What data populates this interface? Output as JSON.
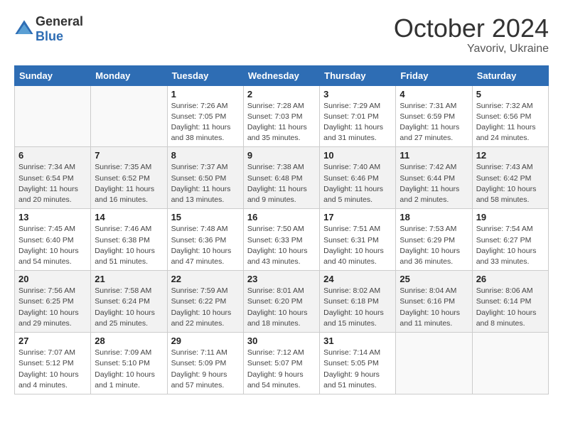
{
  "header": {
    "logo": {
      "text_general": "General",
      "text_blue": "Blue"
    },
    "title": "October 2024",
    "location": "Yavoriv, Ukraine"
  },
  "calendar": {
    "days_of_week": [
      "Sunday",
      "Monday",
      "Tuesday",
      "Wednesday",
      "Thursday",
      "Friday",
      "Saturday"
    ],
    "weeks": [
      {
        "row_bg": "white",
        "days": [
          {
            "num": "",
            "info": ""
          },
          {
            "num": "",
            "info": ""
          },
          {
            "num": "1",
            "info": "Sunrise: 7:26 AM\nSunset: 7:05 PM\nDaylight: 11 hours\nand 38 minutes."
          },
          {
            "num": "2",
            "info": "Sunrise: 7:28 AM\nSunset: 7:03 PM\nDaylight: 11 hours\nand 35 minutes."
          },
          {
            "num": "3",
            "info": "Sunrise: 7:29 AM\nSunset: 7:01 PM\nDaylight: 11 hours\nand 31 minutes."
          },
          {
            "num": "4",
            "info": "Sunrise: 7:31 AM\nSunset: 6:59 PM\nDaylight: 11 hours\nand 27 minutes."
          },
          {
            "num": "5",
            "info": "Sunrise: 7:32 AM\nSunset: 6:56 PM\nDaylight: 11 hours\nand 24 minutes."
          }
        ]
      },
      {
        "row_bg": "gray",
        "days": [
          {
            "num": "6",
            "info": "Sunrise: 7:34 AM\nSunset: 6:54 PM\nDaylight: 11 hours\nand 20 minutes."
          },
          {
            "num": "7",
            "info": "Sunrise: 7:35 AM\nSunset: 6:52 PM\nDaylight: 11 hours\nand 16 minutes."
          },
          {
            "num": "8",
            "info": "Sunrise: 7:37 AM\nSunset: 6:50 PM\nDaylight: 11 hours\nand 13 minutes."
          },
          {
            "num": "9",
            "info": "Sunrise: 7:38 AM\nSunset: 6:48 PM\nDaylight: 11 hours\nand 9 minutes."
          },
          {
            "num": "10",
            "info": "Sunrise: 7:40 AM\nSunset: 6:46 PM\nDaylight: 11 hours\nand 5 minutes."
          },
          {
            "num": "11",
            "info": "Sunrise: 7:42 AM\nSunset: 6:44 PM\nDaylight: 11 hours\nand 2 minutes."
          },
          {
            "num": "12",
            "info": "Sunrise: 7:43 AM\nSunset: 6:42 PM\nDaylight: 10 hours\nand 58 minutes."
          }
        ]
      },
      {
        "row_bg": "white",
        "days": [
          {
            "num": "13",
            "info": "Sunrise: 7:45 AM\nSunset: 6:40 PM\nDaylight: 10 hours\nand 54 minutes."
          },
          {
            "num": "14",
            "info": "Sunrise: 7:46 AM\nSunset: 6:38 PM\nDaylight: 10 hours\nand 51 minutes."
          },
          {
            "num": "15",
            "info": "Sunrise: 7:48 AM\nSunset: 6:36 PM\nDaylight: 10 hours\nand 47 minutes."
          },
          {
            "num": "16",
            "info": "Sunrise: 7:50 AM\nSunset: 6:33 PM\nDaylight: 10 hours\nand 43 minutes."
          },
          {
            "num": "17",
            "info": "Sunrise: 7:51 AM\nSunset: 6:31 PM\nDaylight: 10 hours\nand 40 minutes."
          },
          {
            "num": "18",
            "info": "Sunrise: 7:53 AM\nSunset: 6:29 PM\nDaylight: 10 hours\nand 36 minutes."
          },
          {
            "num": "19",
            "info": "Sunrise: 7:54 AM\nSunset: 6:27 PM\nDaylight: 10 hours\nand 33 minutes."
          }
        ]
      },
      {
        "row_bg": "gray",
        "days": [
          {
            "num": "20",
            "info": "Sunrise: 7:56 AM\nSunset: 6:25 PM\nDaylight: 10 hours\nand 29 minutes."
          },
          {
            "num": "21",
            "info": "Sunrise: 7:58 AM\nSunset: 6:24 PM\nDaylight: 10 hours\nand 25 minutes."
          },
          {
            "num": "22",
            "info": "Sunrise: 7:59 AM\nSunset: 6:22 PM\nDaylight: 10 hours\nand 22 minutes."
          },
          {
            "num": "23",
            "info": "Sunrise: 8:01 AM\nSunset: 6:20 PM\nDaylight: 10 hours\nand 18 minutes."
          },
          {
            "num": "24",
            "info": "Sunrise: 8:02 AM\nSunset: 6:18 PM\nDaylight: 10 hours\nand 15 minutes."
          },
          {
            "num": "25",
            "info": "Sunrise: 8:04 AM\nSunset: 6:16 PM\nDaylight: 10 hours\nand 11 minutes."
          },
          {
            "num": "26",
            "info": "Sunrise: 8:06 AM\nSunset: 6:14 PM\nDaylight: 10 hours\nand 8 minutes."
          }
        ]
      },
      {
        "row_bg": "white",
        "days": [
          {
            "num": "27",
            "info": "Sunrise: 7:07 AM\nSunset: 5:12 PM\nDaylight: 10 hours\nand 4 minutes."
          },
          {
            "num": "28",
            "info": "Sunrise: 7:09 AM\nSunset: 5:10 PM\nDaylight: 10 hours\nand 1 minute."
          },
          {
            "num": "29",
            "info": "Sunrise: 7:11 AM\nSunset: 5:09 PM\nDaylight: 9 hours\nand 57 minutes."
          },
          {
            "num": "30",
            "info": "Sunrise: 7:12 AM\nSunset: 5:07 PM\nDaylight: 9 hours\nand 54 minutes."
          },
          {
            "num": "31",
            "info": "Sunrise: 7:14 AM\nSunset: 5:05 PM\nDaylight: 9 hours\nand 51 minutes."
          },
          {
            "num": "",
            "info": ""
          },
          {
            "num": "",
            "info": ""
          }
        ]
      }
    ]
  }
}
